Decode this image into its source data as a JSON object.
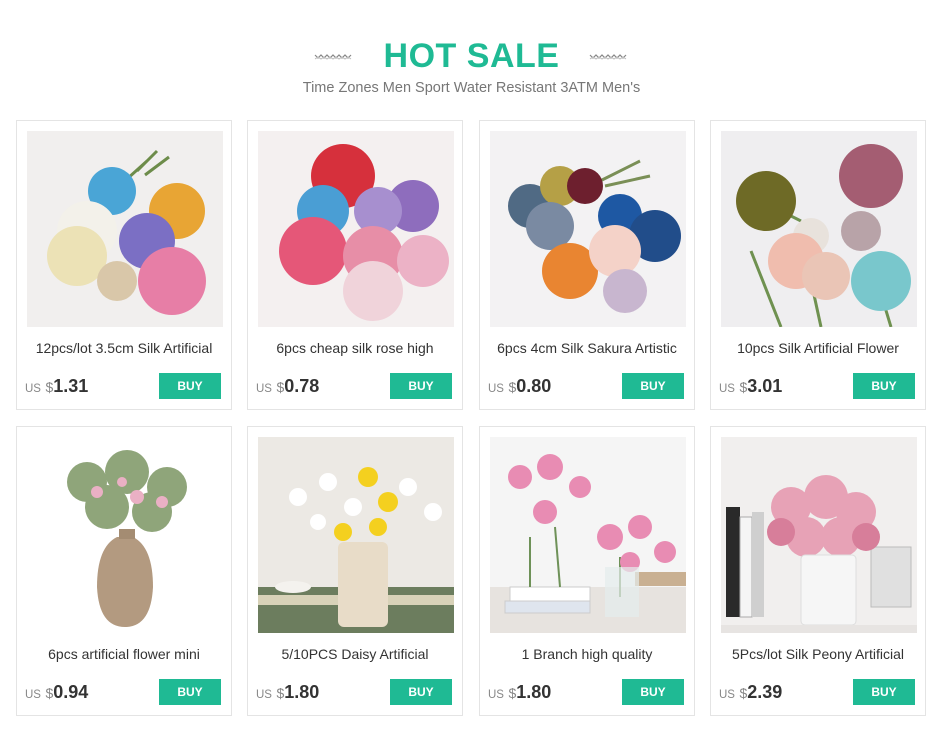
{
  "header": {
    "title": "HOT SALE",
    "subtitle": "Time Zones Men Sport Water Resistant 3ATM Men's"
  },
  "colors": {
    "accent": "#1fba94"
  },
  "products": [
    {
      "name": "12pcs/lot 3.5cm Silk Artificial",
      "currency": "US",
      "symbol": "$",
      "price": "1.31",
      "buy_label": "BUY"
    },
    {
      "name": "6pcs cheap silk rose high",
      "currency": "US",
      "symbol": "$",
      "price": "0.78",
      "buy_label": "BUY"
    },
    {
      "name": "6pcs 4cm Silk Sakura Artistic",
      "currency": "US",
      "symbol": "$",
      "price": "0.80",
      "buy_label": "BUY"
    },
    {
      "name": "10pcs Silk Artificial Flower",
      "currency": "US",
      "symbol": "$",
      "price": "3.01",
      "buy_label": "BUY"
    },
    {
      "name": "6pcs artificial flower mini",
      "currency": "US",
      "symbol": "$",
      "price": "0.94",
      "buy_label": "BUY"
    },
    {
      "name": "5/10PCS Daisy Artificial",
      "currency": "US",
      "symbol": "$",
      "price": "1.80",
      "buy_label": "BUY"
    },
    {
      "name": "1 Branch high quality",
      "currency": "US",
      "symbol": "$",
      "price": "1.80",
      "buy_label": "BUY"
    },
    {
      "name": "5Pcs/lot Silk Peony Artificial",
      "currency": "US",
      "symbol": "$",
      "price": "2.39",
      "buy_label": "BUY"
    }
  ]
}
